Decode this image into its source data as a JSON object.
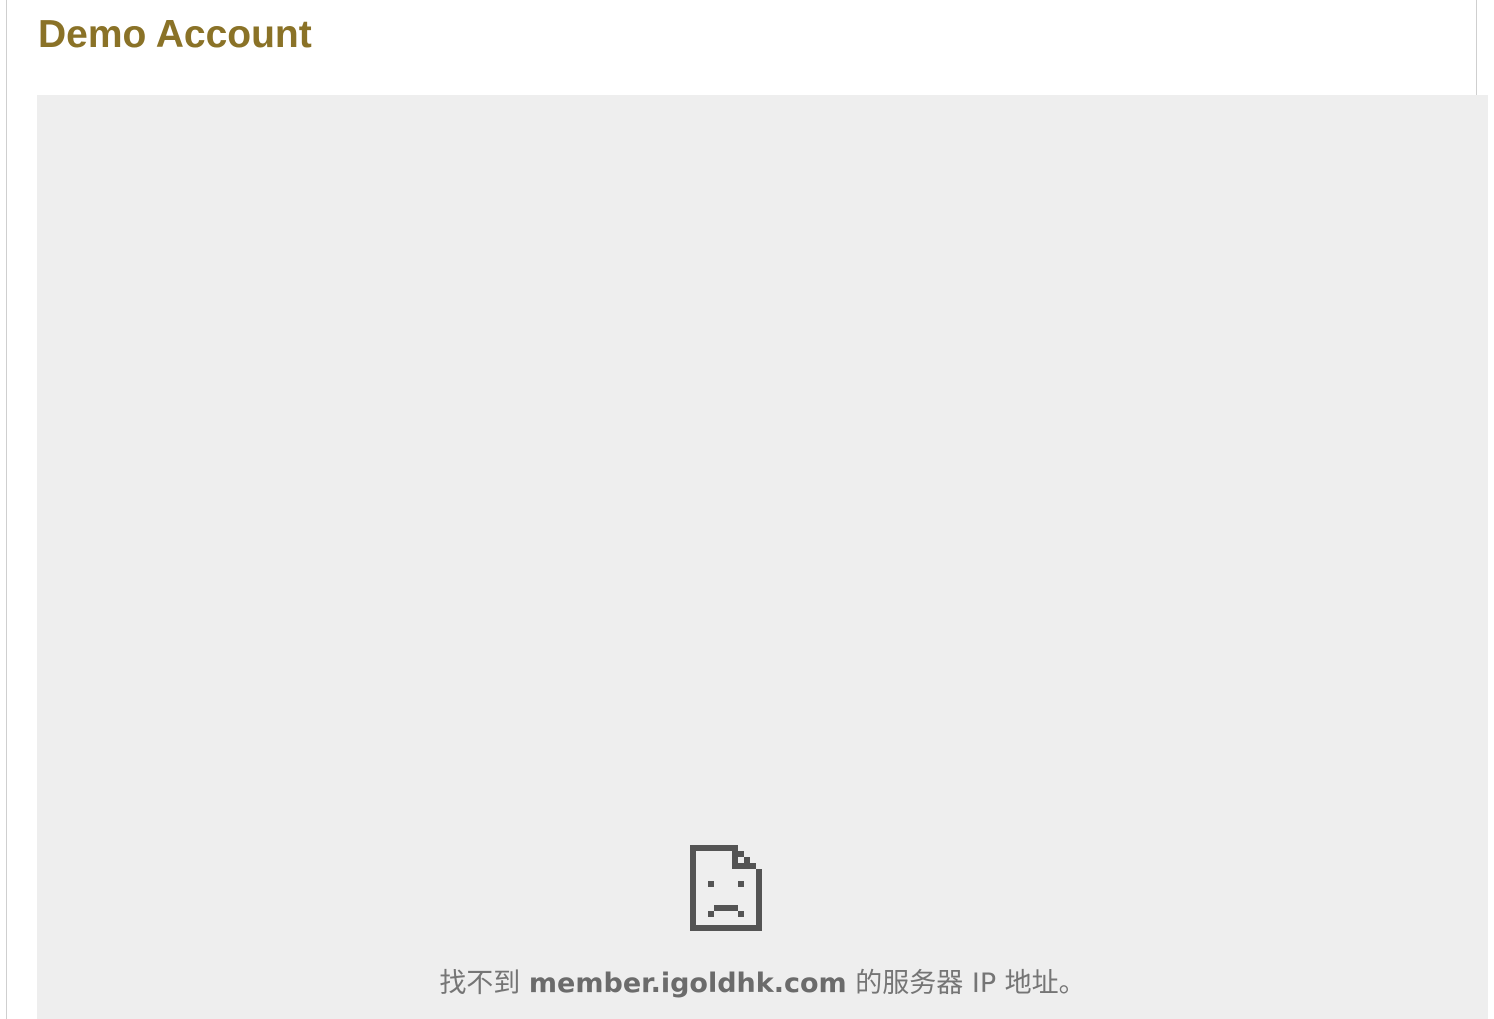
{
  "header": {
    "title": "Demo Account"
  },
  "embedded_frame": {
    "icon": "sad-document-icon",
    "error_prefix": "找不到 ",
    "error_host": "member.igoldhk.com",
    "error_suffix": " 的服务器 IP 地址。",
    "icon_color": "#545454",
    "background_color": "#eeeeee"
  },
  "colors": {
    "title": "#8a7227",
    "text": "#757575"
  }
}
